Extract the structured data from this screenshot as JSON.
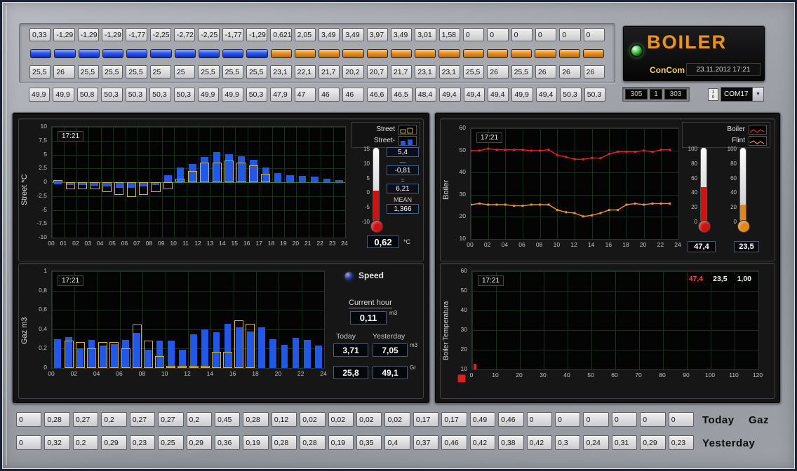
{
  "window": {
    "title": "BOILER"
  },
  "colors": {
    "led_blue": "#2f55f0",
    "led_orange": "#eb8f1e",
    "bar_blue": "#2158e8",
    "bar_outline_yellow": "#d4b43c",
    "line_red": "#e02424",
    "line_orange": "#ef9224",
    "brand_orange": "#e8941e",
    "concom_yellow": "#ffd24a"
  },
  "top": {
    "street_values": [
      "0,33",
      "-1,29",
      "-1,29",
      "-1,29",
      "-1,77",
      "-2,25",
      "-2,72",
      "-2,25",
      "-1,77",
      "-1,29",
      "0,621",
      "2,05",
      "3,49",
      "3,49",
      "3,97",
      "3,49",
      "3,01",
      "1,58",
      "0",
      "0",
      "0",
      "0",
      "0",
      "0"
    ],
    "led_states": [
      "blue",
      "blue",
      "blue",
      "blue",
      "blue",
      "blue",
      "blue",
      "blue",
      "blue",
      "blue",
      "orange",
      "orange",
      "orange",
      "orange",
      "orange",
      "orange",
      "orange",
      "orange",
      "orange",
      "orange",
      "orange",
      "orange",
      "orange",
      "orange"
    ],
    "flint_values": [
      "25,5",
      "26",
      "25,5",
      "25,5",
      "25,5",
      "25",
      "25",
      "25,5",
      "25,5",
      "25,5",
      "23,1",
      "22,1",
      "21,7",
      "20,2",
      "20,7",
      "21,7",
      "23,1",
      "23,1",
      "25,5",
      "26",
      "25,5",
      "26",
      "26",
      "26"
    ],
    "boiler_values": [
      "49,9",
      "49,9",
      "50,8",
      "50,3",
      "50,3",
      "50,3",
      "50,3",
      "49,9",
      "49,9",
      "50,3",
      "47,9",
      "47",
      "46",
      "46",
      "46,6",
      "46,5",
      "48,4",
      "49,4",
      "49,4",
      "49,4",
      "49,9",
      "49,4",
      "50,3",
      "50,3"
    ]
  },
  "brand": {
    "title": "BOILER",
    "subtitle": "ConCom",
    "timestamp": "23.11.2012 17:21",
    "displays": [
      "305",
      "1",
      "303"
    ],
    "com_port": "COM17"
  },
  "street": {
    "axis_label": "Street *C",
    "time_chip": "17:21",
    "legend": [
      {
        "label": "Street"
      },
      {
        "label": "Street-"
      }
    ],
    "thermo": {
      "scale": [
        "15",
        "10",
        "5",
        "0",
        "-5",
        "-10"
      ],
      "fill_pct": 42,
      "color": "#cc1414",
      "max": "5,4",
      "minus": "—",
      "min": "-0,81",
      "equals": "=",
      "diff": "6,21",
      "mean_label": "MEAN",
      "mean": "1,366",
      "current": "0,62",
      "unit": "*C"
    }
  },
  "gaz": {
    "axis_label": "Gaz m3",
    "time_chip": "17:21",
    "speed_label": "Speed",
    "current_hour_label": "Current hour",
    "current_hour": "0,11",
    "unit_m3": "m3",
    "unit_gr": "Gr",
    "today_label": "Today",
    "yesterday_label": "Yesterday",
    "today_total": "3,71",
    "yesterday_total": "7,05",
    "today_gr": "25,8",
    "yesterday_gr": "49,1"
  },
  "boiler": {
    "axis_label": "Boiler",
    "legend": [
      {
        "label": "Boiler"
      },
      {
        "label": "Flint"
      }
    ],
    "thermos": [
      {
        "scale": [
          "100",
          "80",
          "60",
          "40",
          "20",
          "0"
        ],
        "fill_pct": 47.4,
        "color": "#cc1414",
        "value": "47,4"
      },
      {
        "scale": [
          "100",
          "80",
          "60",
          "40",
          "20",
          "0"
        ],
        "fill_pct": 23.5,
        "color": "#e08818",
        "value": "23,5"
      }
    ]
  },
  "btemp": {
    "axis_label": "Boiler Temperatura",
    "time_chip": "17:21",
    "readouts": {
      "v1": "47,4",
      "v2": "23,5",
      "v3": "1,00"
    }
  },
  "bottom": {
    "today_values": [
      "0",
      "0,28",
      "0,27",
      "0,2",
      "0,27",
      "0,27",
      "0,2",
      "0,45",
      "0,28",
      "0,12",
      "0,02",
      "0,02",
      "0,02",
      "0,02",
      "0,17",
      "0,17",
      "0,49",
      "0,46",
      "0",
      "0",
      "0",
      "0",
      "0",
      "0"
    ],
    "yesterday_values": [
      "0",
      "0,32",
      "0,2",
      "0,29",
      "0,23",
      "0,25",
      "0,29",
      "0,36",
      "0,19",
      "0,28",
      "0,28",
      "0,19",
      "0,35",
      "0,4",
      "0,37",
      "0,46",
      "0,42",
      "0,38",
      "0,42",
      "0,3",
      "0,24",
      "0,31",
      "0,29",
      "0,23"
    ],
    "today_label": "Today",
    "gaz_label": "Gaz",
    "yesterday_label": "Yesterday"
  },
  "chart_data": [
    {
      "name": "street",
      "type": "bar",
      "title": "Street *C",
      "ylim": [
        -10,
        10
      ],
      "yticks": [
        "10",
        "7,5",
        "5",
        "2,5",
        "0",
        "-2,5",
        "-5",
        "-7,5",
        "-10"
      ],
      "xticks": [
        "00",
        "01",
        "02",
        "03",
        "04",
        "05",
        "06",
        "07",
        "08",
        "09",
        "10",
        "11",
        "12",
        "13",
        "14",
        "15",
        "16",
        "17",
        "18",
        "19",
        "20",
        "21",
        "22",
        "23",
        "24"
      ],
      "grid": true,
      "legend_position": "top-right",
      "series": [
        {
          "name": "Street",
          "style": "outline",
          "color": "#d4b43c",
          "values": [
            0.33,
            -1.29,
            -1.29,
            -1.29,
            -1.77,
            -2.25,
            -2.72,
            -2.25,
            -1.77,
            -1.29,
            0.62,
            2.05,
            3.49,
            3.49,
            3.97,
            3.49,
            3.01,
            1.58,
            0,
            0,
            0,
            0,
            0,
            0
          ]
        },
        {
          "name": "Street-",
          "style": "fill",
          "color": "#2158e8",
          "values": [
            -0.4,
            -0.5,
            -0.5,
            -0.6,
            -0.8,
            -1,
            -1,
            -0.8,
            -0.5,
            1.3,
            2.7,
            3.3,
            4.5,
            5.4,
            5.1,
            4.7,
            4,
            2.6,
            1.6,
            1.3,
            1.1,
            1,
            0.6,
            0.4
          ]
        }
      ]
    },
    {
      "name": "gaz",
      "type": "bar",
      "title": "Gaz m3",
      "ylim": [
        0,
        1
      ],
      "yticks": [
        "1",
        "0,8",
        "0,6",
        "0,4",
        "0,2",
        "0"
      ],
      "xticks": [
        "00",
        "02",
        "04",
        "06",
        "08",
        "10",
        "12",
        "14",
        "16",
        "18",
        "20",
        "22",
        "24"
      ],
      "grid": true,
      "series": [
        {
          "name": "Today",
          "style": "outline",
          "color": "#d4b43c",
          "values": [
            0,
            0.28,
            0.27,
            0.2,
            0.27,
            0.27,
            0.2,
            0.45,
            0.28,
            0.12,
            0.02,
            0.02,
            0.02,
            0.02,
            0.17,
            0.17,
            0.49,
            0.46,
            0,
            0,
            0,
            0,
            0,
            0
          ]
        },
        {
          "name": "Yesterday",
          "style": "fill",
          "color": "#2158e8",
          "values": [
            0.3,
            0.32,
            0.2,
            0.29,
            0.23,
            0.25,
            0.29,
            0.36,
            0.19,
            0.28,
            0.28,
            0.19,
            0.35,
            0.4,
            0.37,
            0.46,
            0.42,
            0.38,
            0.42,
            0.3,
            0.24,
            0.31,
            0.29,
            0.23
          ]
        }
      ]
    },
    {
      "name": "boiler",
      "type": "line",
      "title": "Boiler",
      "ylim": [
        10,
        60
      ],
      "yticks": [
        "60",
        "50",
        "40",
        "30",
        "20",
        "10"
      ],
      "xticks": [
        "00",
        "02",
        "04",
        "06",
        "08",
        "10",
        "12",
        "14",
        "16",
        "18",
        "20",
        "22",
        "24"
      ],
      "grid": true,
      "legend_position": "top-right",
      "series": [
        {
          "name": "Boiler",
          "color": "#e02424",
          "values": [
            49.9,
            49.9,
            50.8,
            50.3,
            50.3,
            50.3,
            50.3,
            49.9,
            49.9,
            50.3,
            47.9,
            47,
            46,
            46,
            46.6,
            46.5,
            48.4,
            49.4,
            49.4,
            49.4,
            49.9,
            49.4,
            50.3,
            50.3
          ]
        },
        {
          "name": "Flint",
          "color": "#ef9224",
          "values": [
            25.5,
            26,
            25.5,
            25.5,
            25.5,
            25,
            25,
            25.5,
            25.5,
            25.5,
            23.1,
            22.1,
            21.7,
            20.2,
            20.7,
            21.7,
            23.1,
            23.1,
            25.5,
            26,
            25.5,
            26,
            26,
            26
          ]
        }
      ]
    },
    {
      "name": "boiler_temperatura",
      "type": "bar",
      "title": "Boiler Temperatura",
      "ylim": [
        10,
        60
      ],
      "xlim": [
        0,
        120
      ],
      "yticks": [
        "60",
        "50",
        "40",
        "30",
        "20",
        "10"
      ],
      "xticks": [
        "0",
        "10",
        "20",
        "30",
        "40",
        "50",
        "60",
        "70",
        "80",
        "90",
        "100",
        "110",
        "120"
      ],
      "grid": true,
      "series": [
        {
          "name": "Boiler",
          "color": "#e02424",
          "x": [
            0
          ],
          "values": [
            13
          ]
        }
      ]
    }
  ]
}
